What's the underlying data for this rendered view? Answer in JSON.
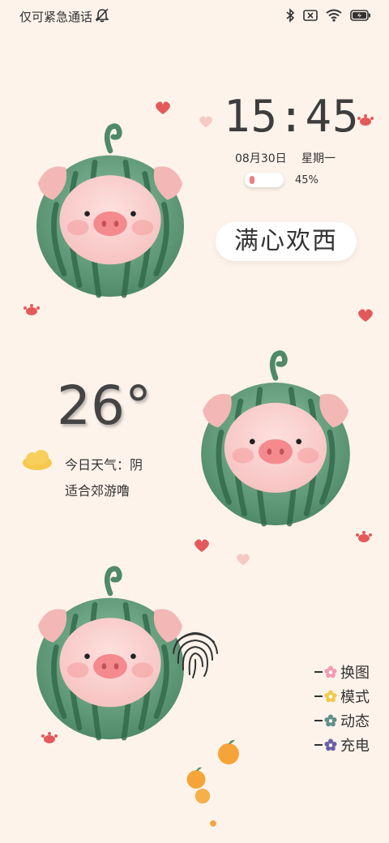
{
  "status_bar": {
    "carrier_text": "仅可紧急通话",
    "icons": [
      "bell-off-icon",
      "bluetooth-icon",
      "no-sim-icon",
      "wifi-icon",
      "battery-charging-icon"
    ]
  },
  "clock": {
    "time": "15:45",
    "date": "08月30日",
    "weekday": "星期一",
    "battery_percent": "45%",
    "battery_level": 0.45
  },
  "slogan": "满心欢西",
  "weather": {
    "temperature": "26°",
    "today": "今日天气：阴",
    "tip": "适合郊游噜"
  },
  "menu": {
    "items": [
      {
        "label": "换图",
        "color": "#f29bb2"
      },
      {
        "label": "模式",
        "color": "#f2c94c"
      },
      {
        "label": "动态",
        "color": "#5f8f88"
      },
      {
        "label": "充电",
        "color": "#6b5fa8"
      }
    ]
  },
  "colors": {
    "background": "#fdf3ea",
    "watermelon": "#5f9a78",
    "pig_pink": "#f7c8c8",
    "snout": "#f48a8e"
  }
}
